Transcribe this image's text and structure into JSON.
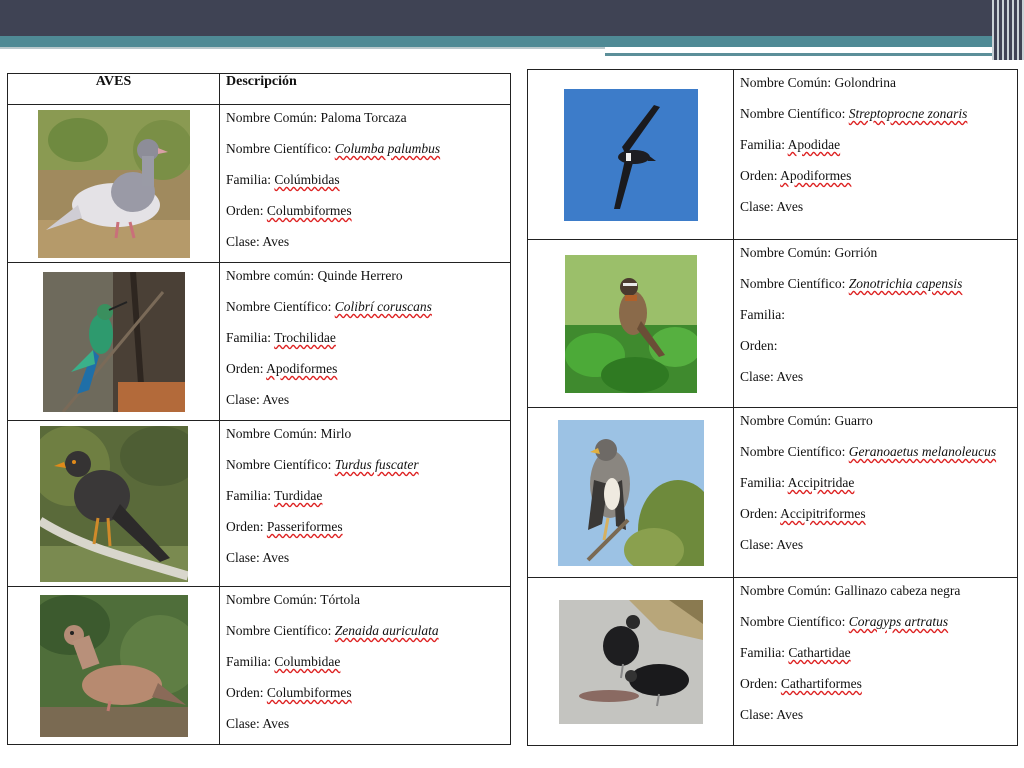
{
  "headers": {
    "col1": "AVES",
    "col2": "Descripción"
  },
  "left_birds": [
    {
      "photo": "paloma-photo",
      "lines": [
        {
          "label": "Nombre Común: ",
          "value": "Paloma Torcaza",
          "style": "plain"
        },
        {
          "label": "Nombre Científico:  ",
          "value": "Columba palumbus",
          "style": "sci"
        },
        {
          "label": "Familia:  ",
          "value": "Colúmbidas",
          "style": "fam"
        },
        {
          "label": "Orden: ",
          "value": "Columbiformes",
          "style": "fam"
        },
        {
          "label": "Clase: ",
          "value": "Aves",
          "style": "plain"
        }
      ]
    },
    {
      "photo": "quinde-photo",
      "lines": [
        {
          "label": "Nombre común: ",
          "value": "Quinde Herrero",
          "style": "plain"
        },
        {
          "label": "Nombre Científico:  ",
          "value": "Colibrí coruscans",
          "style": "sci"
        },
        {
          "label": "Familia:  ",
          "value": "Trochilidae",
          "style": "fam"
        },
        {
          "label": "Orden:   ",
          "value": "Apodiformes",
          "style": "fam"
        },
        {
          "label": "Clase: ",
          "value": "Aves",
          "style": "plain"
        }
      ]
    },
    {
      "photo": "mirlo-photo",
      "lines": [
        {
          "label": "Nombre Común: ",
          "value": "Mirlo",
          "style": "plain"
        },
        {
          "label": "Nombre Científico:  ",
          "value": "Turdus fuscater",
          "style": "sci"
        },
        {
          "label": "Familia:  ",
          "value": "Turdidae",
          "style": "fam"
        },
        {
          "label": "Orden:   ",
          "value": "Passeriformes",
          "style": "fam"
        },
        {
          "label": "Clase: ",
          "value": "Aves",
          "style": "plain"
        }
      ]
    },
    {
      "photo": "tortola-photo",
      "lines": [
        {
          "label": "Nombre Común: ",
          "value": "Tórtola",
          "style": "plain"
        },
        {
          "label": "Nombre Científico:  ",
          "value": "Zenaida auriculata",
          "style": "sci"
        },
        {
          "label": "Familia:  ",
          "value": "Columbidae",
          "style": "fam"
        },
        {
          "label": "Orden:   ",
          "value": "Columbiformes",
          "style": "fam"
        },
        {
          "label": "Clase: ",
          "value": "Aves",
          "style": "plain"
        }
      ]
    }
  ],
  "right_birds": [
    {
      "photo": "golondrina-photo",
      "lines": [
        {
          "label": "Nombre Común: ",
          "value": "Golondrina",
          "style": "plain"
        },
        {
          "label": "Nombre Científico:  ",
          "value": "Streptoprocne zonaris",
          "style": "sci"
        },
        {
          "label": "Familia:  ",
          "value": "Apodidae",
          "style": "fam"
        },
        {
          "label": "Orden:   ",
          "value": "Apodiformes",
          "style": "fam"
        },
        {
          "label": "Clase: ",
          "value": "Aves",
          "style": "plain"
        }
      ]
    },
    {
      "photo": "gorrion-photo",
      "lines": [
        {
          "label": "Nombre Común: ",
          "value": "Gorrión",
          "style": "plain"
        },
        {
          "label": "Nombre Científico:  ",
          "value": "Zonotrichia capensis",
          "style": "sci"
        },
        {
          "label": "Familia:",
          "value": "",
          "style": "plain"
        },
        {
          "label": "Orden:",
          "value": "",
          "style": "plain"
        },
        {
          "label": "Clase: ",
          "value": "Aves",
          "style": "plain"
        }
      ]
    },
    {
      "photo": "guarro-photo",
      "lines": [
        {
          "label": "Nombre Común: ",
          "value": "Guarro",
          "style": "plain"
        },
        {
          "label": "Nombre Científico:  ",
          "value": "Geranoaetus melanoleucus",
          "style": "sci"
        },
        {
          "label": "Familia:  ",
          "value": "Accipitridae",
          "style": "fam"
        },
        {
          "label": "Orden:   ",
          "value": "Accipitriformes",
          "style": "fam"
        },
        {
          "label": "Clase: ",
          "value": "Aves",
          "style": "plain"
        }
      ]
    },
    {
      "photo": "gallinazo-photo",
      "lines": [
        {
          "label": "Nombre Común: ",
          "value": "Gallinazo cabeza negra",
          "style": "plain"
        },
        {
          "label": "Nombre Científico:  ",
          "value": "Coragyps artratus",
          "style": "sci"
        },
        {
          "label": "Familia:  ",
          "value": "Cathartidae",
          "style": "fam"
        },
        {
          "label": "Orden:   ",
          "value": "Cathartiformes",
          "style": "fam"
        },
        {
          "label": "Clase: ",
          "value": "Aves",
          "style": "plain"
        }
      ]
    }
  ]
}
